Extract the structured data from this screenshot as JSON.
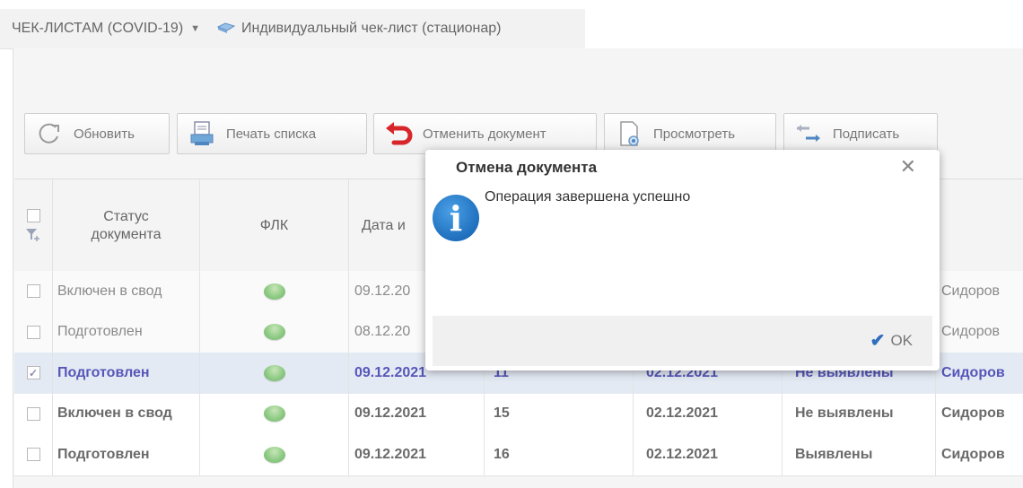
{
  "breadcrumb": {
    "item1": "ЧЕК-ЛИСТАМ (COVID-19)",
    "item2": "Индивидуальный чек-лист (стационар)"
  },
  "toolbar": {
    "refresh": "Обновить",
    "print": "Печать списка",
    "cancel_doc": "Отменить документ",
    "view": "Просмотреть",
    "sign": "Подписать"
  },
  "grid": {
    "headers": {
      "status": "Статус\nдокумента",
      "flk": "ФЛК",
      "date": "Дата и"
    },
    "rows": [
      {
        "status": "Включен в свод",
        "date": "09.12.20",
        "num": "",
        "date2": "",
        "result": "",
        "person": "Сидоров",
        "selected": false,
        "checked": false
      },
      {
        "status": "Подготовлен",
        "date": "08.12.20",
        "num": "",
        "date2": "",
        "result": "",
        "person": "Сидоров",
        "selected": false,
        "checked": false
      },
      {
        "status": "Подготовлен",
        "date": "09.12.2021",
        "num": "11",
        "date2": "02.12.2021",
        "result": "Не выявлены",
        "person": "Сидоров",
        "selected": true,
        "checked": true
      },
      {
        "status": "Включен в свод",
        "date": "09.12.2021",
        "num": "15",
        "date2": "02.12.2021",
        "result": "Не выявлены",
        "person": "Сидоров",
        "selected": false,
        "checked": false
      },
      {
        "status": "Подготовлен",
        "date": "09.12.2021",
        "num": "16",
        "date2": "02.12.2021",
        "result": "Выявлены",
        "person": "Сидоров",
        "selected": false,
        "checked": false
      }
    ]
  },
  "dialog": {
    "title": "Отмена документа",
    "message": "Операция завершена успешно",
    "ok": "OK",
    "close_glyph": "✕",
    "info_glyph": "i",
    "check_glyph": "✔"
  },
  "colors": {
    "selected_text": "#5656b8",
    "selected_bg": "#e4eaf4",
    "info_blue": "#1f6fbd",
    "status_dot": "#8fcb85"
  }
}
